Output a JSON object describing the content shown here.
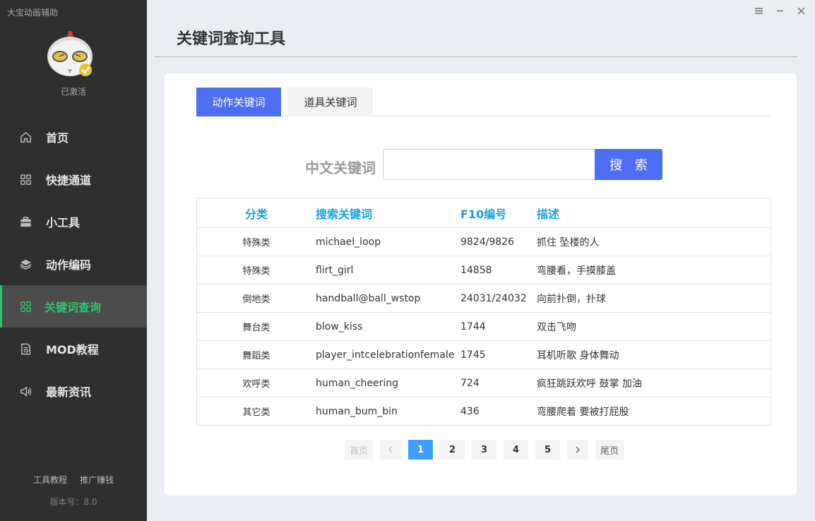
{
  "app": {
    "title": "大宝动画辅助",
    "status": "已激活",
    "version": "版本号：8.0"
  },
  "sidebar": {
    "items": [
      {
        "label": "首页",
        "icon": "home-icon"
      },
      {
        "label": "快捷通道",
        "icon": "grid-icon"
      },
      {
        "label": "小工具",
        "icon": "toolbox-icon"
      },
      {
        "label": "动作编码",
        "icon": "layers-icon"
      },
      {
        "label": "关键词查询",
        "icon": "grid-icon",
        "active": true
      },
      {
        "label": "MOD教程",
        "icon": "document-icon"
      },
      {
        "label": "最新资讯",
        "icon": "speaker-icon"
      }
    ],
    "footer": {
      "tutorial": "工具教程",
      "promo": "推广赚钱"
    }
  },
  "page": {
    "title": "关键词查询工具"
  },
  "tabs": [
    {
      "label": "动作关键词",
      "active": true
    },
    {
      "label": "道具关键词"
    }
  ],
  "search": {
    "label": "中文关键词",
    "value": "",
    "button": "搜 索"
  },
  "table": {
    "headers": [
      "分类",
      "搜索关键词",
      "F10编号",
      "描述"
    ],
    "rows": [
      [
        "特殊类",
        "michael_loop",
        "9824/9826",
        "抓住 坠楼的人"
      ],
      [
        "特殊类",
        "flirt_girl",
        "14858",
        "弯腰看，手摸膝盖"
      ],
      [
        "倒地类",
        "handball@ball_wstop",
        "24031/24032",
        "向前扑倒，扑球"
      ],
      [
        "舞台类",
        "blow_kiss",
        "1744",
        "双击飞吻"
      ],
      [
        "舞蹈类",
        "player_intcelebrationfemale",
        "1745",
        "耳机听歌 身体舞动"
      ],
      [
        "欢呼类",
        "human_cheering",
        "724",
        "疯狂跳跃欢呼 鼓掌 加油"
      ],
      [
        "其它类",
        "human_bum_bin",
        "436",
        "弯腰爬着 要被打屁股"
      ]
    ]
  },
  "pagination": {
    "first": "首页",
    "last": "尾页",
    "pages": [
      "1",
      "2",
      "3",
      "4",
      "5"
    ],
    "current": "1"
  },
  "colors": {
    "accent": "#4e6ef2",
    "active_nav": "#2ec46d",
    "table_header": "#1ba2dc",
    "pager_current": "#409eff"
  }
}
